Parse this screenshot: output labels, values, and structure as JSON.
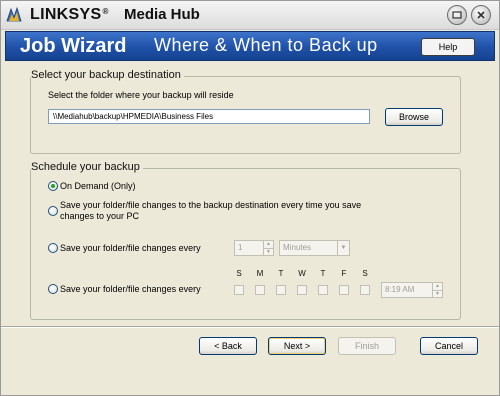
{
  "window": {
    "brand": "LINKSYS",
    "brand_mark": "®",
    "product": "Media Hub",
    "minimize_icon": "minimize-icon",
    "close_icon": "close-icon"
  },
  "banner": {
    "title": "Job Wizard",
    "subtitle": "Where & When to Back up",
    "help_label": "Help"
  },
  "destination": {
    "legend": "Select your backup destination",
    "instruction": "Select the folder where your backup will reside",
    "path_value": "\\\\Mediahub\\backup\\HPMEDIA\\Business Files",
    "browse_label": "Browse"
  },
  "schedule": {
    "legend": "Schedule your backup",
    "options": [
      {
        "label": "On Demand (Only)",
        "checked": true
      },
      {
        "label": "Save your folder/file changes to the backup destination every time you save changes to your PC",
        "checked": false
      },
      {
        "label": "Save your folder/file changes every",
        "checked": false
      },
      {
        "label": "Save your folder/file changes every",
        "checked": false
      }
    ],
    "interval_value": "1",
    "interval_unit": "Minutes",
    "days": [
      "S",
      "M",
      "T",
      "W",
      "T",
      "F",
      "S"
    ],
    "time_value": "8:19 AM"
  },
  "footer": {
    "back_label": "< Back",
    "next_label": "Next >",
    "finish_label": "Finish",
    "cancel_label": "Cancel"
  },
  "colors": {
    "banner": "#1f51a8",
    "dialog_bg": "#ece9d8",
    "radio_dot": "#21a121"
  }
}
